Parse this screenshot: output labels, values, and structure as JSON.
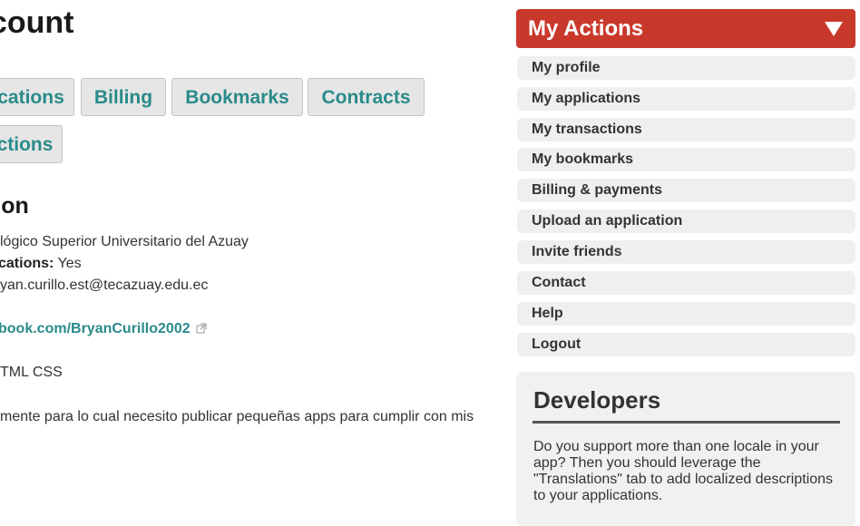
{
  "main": {
    "title": "ccount",
    "tabs": [
      {
        "label": "cations"
      },
      {
        "label": "Billing"
      },
      {
        "label": "Bookmarks"
      },
      {
        "label": "Contracts"
      },
      {
        "label": "ctions"
      }
    ],
    "section_title": "tion",
    "info": {
      "institution": "lógico Superior Universitario del Azuay",
      "publications_label": "cations:",
      "publications_value": "Yes",
      "email": "yan.curillo.est@tecazuay.edu.ec",
      "link": "book.com/BryanCurillo2002",
      "skills": "TML CSS",
      "about": "mente para lo cual necesito publicar pequeñas apps para cumplir con mis"
    }
  },
  "sidebar": {
    "header": "My Actions",
    "items": [
      {
        "label": "My profile"
      },
      {
        "label": "My applications"
      },
      {
        "label": "My transactions"
      },
      {
        "label": "My bookmarks"
      },
      {
        "label": "Billing & payments"
      },
      {
        "label": "Upload an application"
      },
      {
        "label": "Invite friends"
      },
      {
        "label": "Contact"
      },
      {
        "label": "Help"
      },
      {
        "label": "Logout"
      }
    ],
    "developers": {
      "title": "Developers",
      "text": "Do you support more than one locale in your app? Then you should leverage the \"Translations\" tab to add localized descriptions to your applications."
    }
  },
  "colors": {
    "accent_red": "#c9392b",
    "link_teal": "#2a8a8a"
  }
}
